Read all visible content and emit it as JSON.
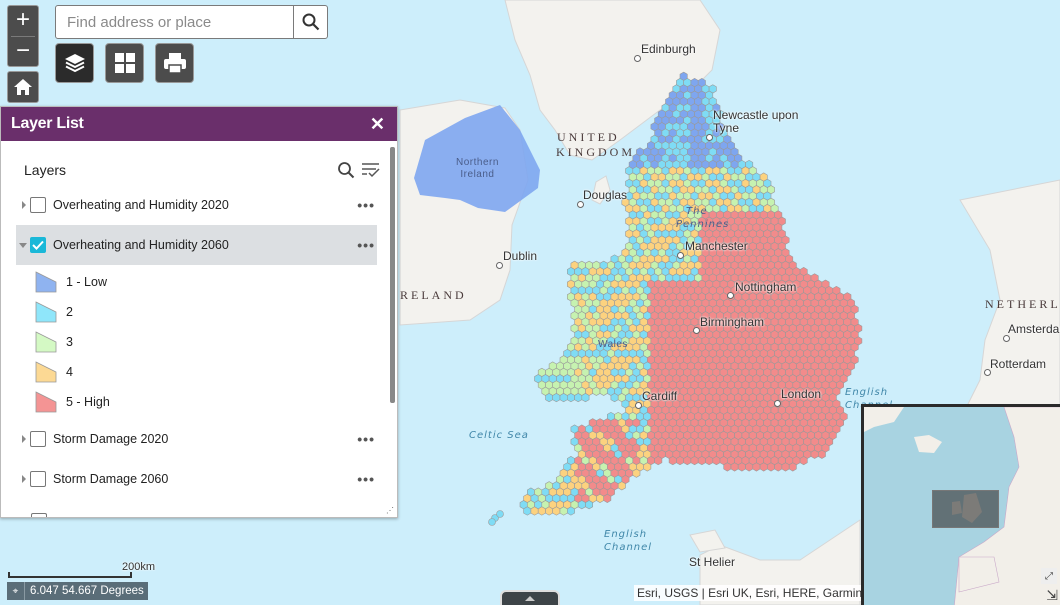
{
  "map": {
    "cities": [
      {
        "name": "Edinburgh",
        "key": "edinburgh"
      },
      {
        "name": "Newcastle upon Tyne",
        "key": "newcastle"
      },
      {
        "name": "Douglas",
        "key": "douglas"
      },
      {
        "name": "Dublin",
        "key": "dublin"
      },
      {
        "name": "Manchester",
        "key": "manchester"
      },
      {
        "name": "Nottingham",
        "key": "nottingham"
      },
      {
        "name": "Birmingham",
        "key": "birmingham"
      },
      {
        "name": "Cardiff",
        "key": "cardiff"
      },
      {
        "name": "London",
        "key": "london"
      },
      {
        "name": "Amsterdam",
        "key": "amsterdam"
      },
      {
        "name": "Rotterdam",
        "key": "rotterdam"
      },
      {
        "name": "St Helier",
        "key": "sthelier"
      }
    ],
    "countries": {
      "uk_line1": "UNITED",
      "uk_line2": "KINGDOM",
      "ireland": "RELAND",
      "netherlands": "NETHERL"
    },
    "seas": {
      "celtic": "Celtic Sea",
      "channel_line1": "English",
      "channel_line2": "Channel",
      "channel_east1": "English",
      "channel_east2": "Channel"
    },
    "regions": {
      "ni_line1": "Northern",
      "ni_line2": "Ireland",
      "pennines_line1": "The",
      "pennines_line2": "Pennines",
      "wales": "Wales"
    },
    "hex_classes": [
      {
        "value": 1,
        "color": "#7ea6f0"
      },
      {
        "value": 2,
        "color": "#7fdcf5"
      },
      {
        "value": 3,
        "color": "#c6f2b0"
      },
      {
        "value": 4,
        "color": "#fcd27f"
      },
      {
        "value": 5,
        "color": "#f28b8b"
      }
    ]
  },
  "search": {
    "placeholder": "Find address or place"
  },
  "widgets": {
    "zoom_in": "+",
    "zoom_out": "−"
  },
  "layer_list": {
    "title": "Layer List",
    "close": "✕",
    "section_title": "Layers",
    "layers": [
      {
        "name": "Overheating and Humidity 2020",
        "checked": false,
        "expanded": false
      },
      {
        "name": "Overheating and Humidity 2060",
        "checked": true,
        "expanded": true
      },
      {
        "name": "Storm Damage 2020",
        "checked": false,
        "expanded": false
      },
      {
        "name": "Storm Damage 2060",
        "checked": false,
        "expanded": false
      }
    ],
    "legend": [
      {
        "label": "1 - Low",
        "color": "#8fb3f0"
      },
      {
        "label": "2",
        "color": "#8fe6fa"
      },
      {
        "label": "3",
        "color": "#d4f9c4"
      },
      {
        "label": "4",
        "color": "#fcd994"
      },
      {
        "label": "5 - High",
        "color": "#f49494"
      }
    ],
    "more_label": "•••"
  },
  "scale": {
    "label": "200km"
  },
  "coordinates": {
    "text": "6.047 54.667 Degrees"
  },
  "attribution": {
    "text": "Esri, USGS | Esri UK, Esri, HERE, Garmin"
  }
}
